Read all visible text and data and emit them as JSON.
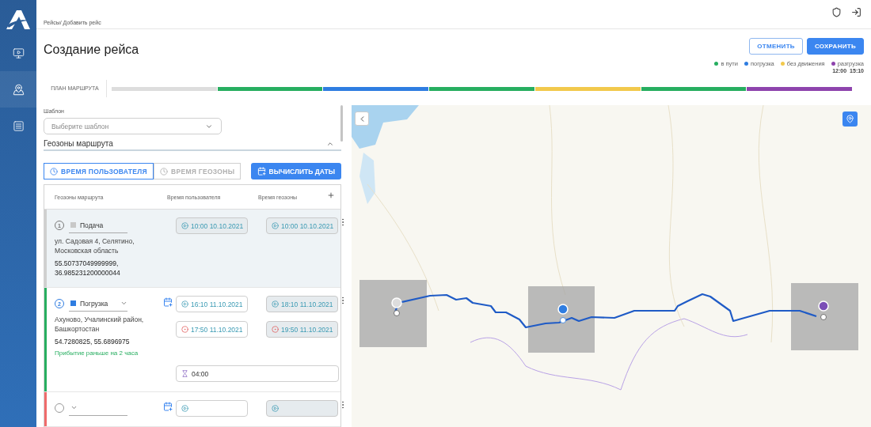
{
  "breadcrumb": "Рейсы/ Добавить рейс",
  "sidebar": {
    "items": [
      {
        "selected": false
      },
      {
        "selected": true
      },
      {
        "selected": false
      }
    ]
  },
  "title": "Создание рейса",
  "actions": [
    {
      "label": "ОТМЕНИТЬ",
      "kind": "outline"
    },
    {
      "label": "СОХРАНИТЬ",
      "kind": "primary"
    }
  ],
  "legend": [
    {
      "label": "в пути",
      "color": "#27ae60"
    },
    {
      "label": "погрузка",
      "color": "#2f7de1"
    },
    {
      "label": "без движения",
      "color": "#f2c94c"
    },
    {
      "label": "разгрузка",
      "color": "#8e44ad"
    }
  ],
  "legend_times": [
    "12:00",
    "15:10"
  ],
  "plan": {
    "label": "ПЛАН МАРШРУТА",
    "segments": [
      {
        "color": "#dddddd"
      },
      {
        "color": "#27ae60"
      },
      {
        "color": "#2f7de1"
      },
      {
        "color": "#27ae60"
      },
      {
        "color": "#f2c94c"
      },
      {
        "color": "#27ae60"
      },
      {
        "color": "#8e44ad"
      }
    ]
  },
  "template": {
    "label": "Шаблон",
    "placeholder": "Выберите шаблон"
  },
  "geozones_section": {
    "title": "Геозоны маршрута",
    "expanded": true
  },
  "time_modes": [
    {
      "label": "ВРЕМЯ ПОЛЬЗОВАТЕЛЯ",
      "selected": true
    },
    {
      "label": "ВРЕМЯ ГЕОЗОНЫ",
      "selected": false
    }
  ],
  "compute_button": "ВЫЧИСЛИТЬ ДАТЫ",
  "table": {
    "columns": [
      "Геозоны маршрута",
      "Время пользователя",
      "Время геозоны"
    ],
    "rows": [
      {
        "number": "1",
        "type": {
          "label": "Подача",
          "color": "#c8c8c8"
        },
        "selected": true,
        "color": "#cfcfcf",
        "dropdown": false,
        "calendar": false,
        "address": "ул. Садовая 4, Селятино, Московская область",
        "coords": "55.50737049999999, 36.985231200000044",
        "user_times": [
          {
            "value": "10:00 10.10.2021",
            "kind": "start",
            "disabled": true
          }
        ],
        "geo_times": [
          {
            "value": "10:00 10.10.2021",
            "kind": "start",
            "disabled": true
          }
        ]
      },
      {
        "number": "2",
        "type": {
          "label": "Погрузка",
          "color": "#2f7de1"
        },
        "selected": false,
        "color": "#27ae60",
        "dropdown": true,
        "calendar": true,
        "address": "Ахуново, Учалинский район, Башкортостан",
        "coords": "54.7280825, 55.6896975",
        "note": "Прибытие раньше на 2 часа",
        "user_times": [
          {
            "value": "16:10 11.10.2021",
            "kind": "start",
            "disabled": false
          },
          {
            "value": "17:50 11.10.2021",
            "kind": "end",
            "disabled": false
          }
        ],
        "geo_times": [
          {
            "value": "18:10 11.10.2021",
            "kind": "start",
            "disabled": true
          },
          {
            "value": "19:50 11.10.2021",
            "kind": "end",
            "disabled": true
          }
        ],
        "duration": "04:00"
      },
      {
        "selected": false,
        "color": "#ef6b6b",
        "dropdown": true,
        "calendar": true,
        "user_times": [
          {
            "kind": "start",
            "disabled": false
          }
        ],
        "geo_times": [
          {
            "kind": "start",
            "disabled": true
          }
        ]
      }
    ]
  }
}
